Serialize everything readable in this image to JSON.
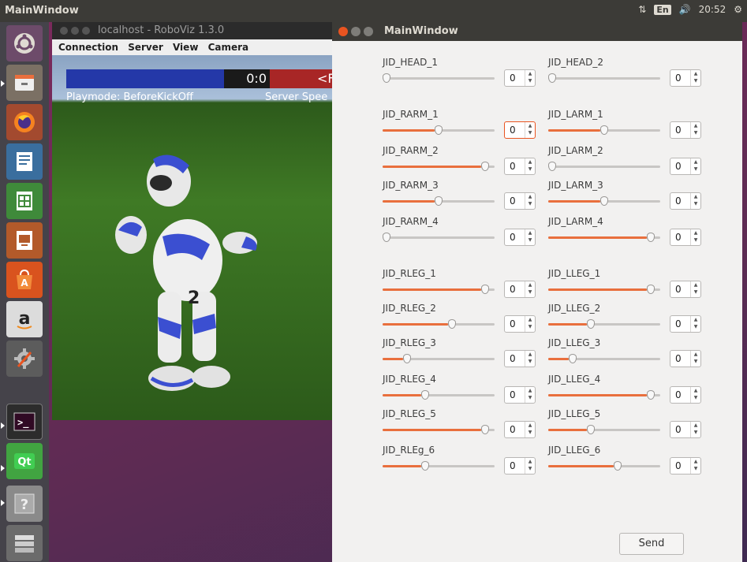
{
  "top_panel": {
    "title": "MainWindow",
    "keyboard": "En",
    "time": "20:52"
  },
  "roboviz": {
    "title": "localhost - RoboViz 1.3.0",
    "menu": [
      "Connection",
      "Server",
      "View",
      "Camera"
    ],
    "score": "0:0",
    "right_team_partial": "<F",
    "playmode": "Playmode: BeforeKickOff",
    "server_speed_partial": "Server Spee"
  },
  "main_window": {
    "title": "MainWindow",
    "joints": [
      {
        "label": "JID_HEAD_1",
        "value": "0",
        "level": 0.0
      },
      {
        "label": "JID_HEAD_2",
        "value": "0",
        "level": 0.0
      },
      {
        "label": "JID_RARM_1",
        "value": "0",
        "level": 0.5,
        "focused": true
      },
      {
        "label": "JID_LARM_1",
        "value": "0",
        "level": 0.5
      },
      {
        "label": "JID_RARM_2",
        "value": "0",
        "level": 0.95
      },
      {
        "label": "JID_LARM_2",
        "value": "0",
        "level": 0.0
      },
      {
        "label": "JID_RARM_3",
        "value": "0",
        "level": 0.5
      },
      {
        "label": "JID_LARM_3",
        "value": "0",
        "level": 0.5
      },
      {
        "label": "JID_RARM_4",
        "value": "0",
        "level": 0.0
      },
      {
        "label": "JID_LARM_4",
        "value": "0",
        "level": 0.95
      },
      {
        "label": "JID_RLEG_1",
        "value": "0",
        "level": 0.95
      },
      {
        "label": "JID_LLEG_1",
        "value": "0",
        "level": 0.95
      },
      {
        "label": "JID_RLEG_2",
        "value": "0",
        "level": 0.63
      },
      {
        "label": "JID_LLEG_2",
        "value": "0",
        "level": 0.37
      },
      {
        "label": "JID_RLEG_3",
        "value": "0",
        "level": 0.2
      },
      {
        "label": "JID_LLEG_3",
        "value": "0",
        "level": 0.2
      },
      {
        "label": "JID_RLEG_4",
        "value": "0",
        "level": 0.37
      },
      {
        "label": "JID_LLEG_4",
        "value": "0",
        "level": 0.95
      },
      {
        "label": "JID_RLEG_5",
        "value": "0",
        "level": 0.95
      },
      {
        "label": "JID_LLEG_5",
        "value": "0",
        "level": 0.37
      },
      {
        "label": "JID_RLEg_6",
        "value": "0",
        "level": 0.37
      },
      {
        "label": "JID_LLEG_6",
        "value": "0",
        "level": 0.63
      }
    ],
    "send_label": "Send"
  }
}
